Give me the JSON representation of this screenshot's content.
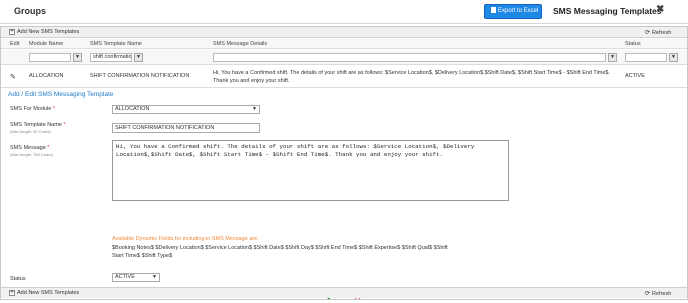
{
  "header": {
    "title": "Groups",
    "export_label": "Export to Excel",
    "panel_title": "SMS Messaging Templates",
    "close_glyph": "✖"
  },
  "toolbar": {
    "add_label": "Add New SMS Templates",
    "refresh_label": "Refresh"
  },
  "columns": {
    "edit": "Edit",
    "module": "Module Name",
    "template": "SMS Template Name",
    "details": "SMS Message Details",
    "status": "Status"
  },
  "filters": {
    "module": "",
    "template": "shift confirmatio",
    "details": "",
    "status": ""
  },
  "row": {
    "module": "ALLOCATION",
    "template": "SHIFT CONFIRMATION NOTIFICATION",
    "details": "Hi, You have a Confirmed shift. The details of your shift are as follows: $Service Location$, $Delivery Location$,$Shift Date$, $Shift Start Time$ - $Shift End Time$. Thank you and enjoy your shift.",
    "status": "ACTIVE"
  },
  "form": {
    "title": "Add / Edit SMS Messaging Template",
    "module_label": "SMS For Module",
    "module_value": "ALLOCATION",
    "template_label": "SMS Template Name",
    "template_hint": "(Max length: 50 Chars)",
    "template_value": "SHIFT CONFIRMATION NOTIFICATION",
    "message_label": "SMS Message",
    "message_hint": "(Max length: 760 Chars)",
    "message_value": "Hi, You have a Confirmed shift. The details of your shift are as follows: $Service Location$, $Delivery Location$,$Shift Date$,  $Shift Start Time$ - $Shift End Time$. Thank you and enjoy your shift.",
    "dynamic_title": "Available Dynamic Fields for including in SMS Message are:",
    "dynamic_fields": "$Booking Notes$  $Delivery Location$  $Service Location$  $Shift Date$  $Shift Day$  $Shift End Time$  $Shift Expertise$  $Shift Qual$  $Shift Start Time$  $Shift Type$",
    "status_label": "Status",
    "status_value": "ACTIVE",
    "required_mark": "*"
  },
  "colors": {
    "accent": "#1e88e5",
    "ok": "#2e9b2e",
    "cancel": "#d32f2f",
    "hint": "#f08a3c"
  }
}
